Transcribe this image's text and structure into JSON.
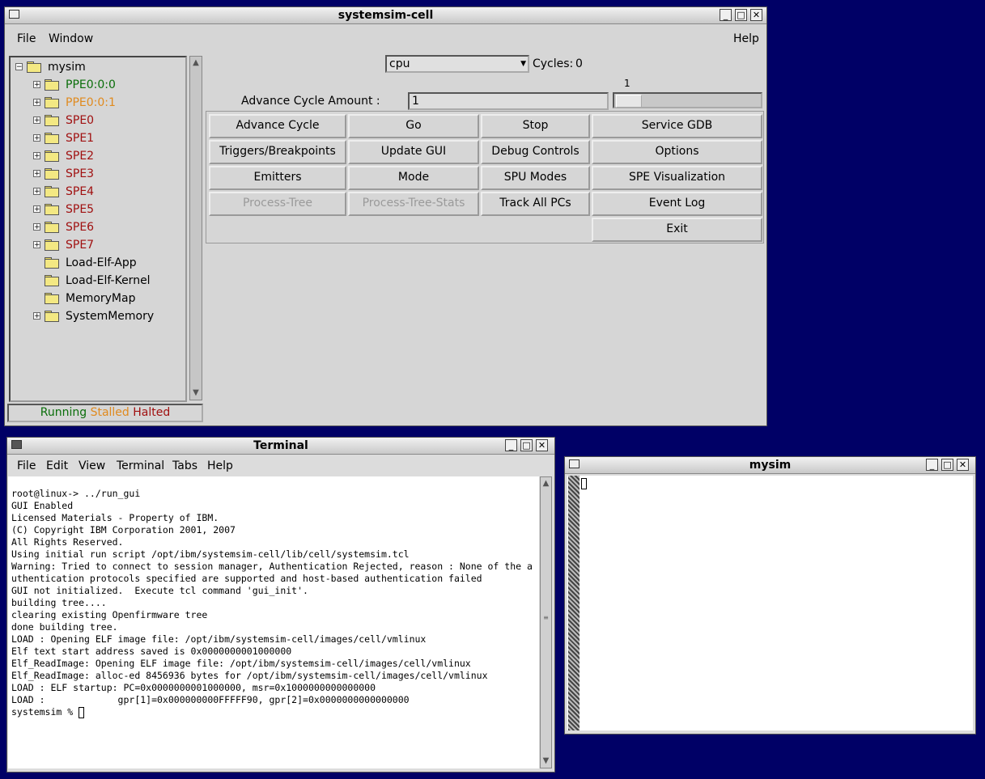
{
  "main_window": {
    "title": "systemsim-cell",
    "menu": {
      "file": "File",
      "window": "Window",
      "help": "Help"
    },
    "tree": [
      {
        "label": "mysim",
        "expander": "minus",
        "color": "#000000"
      },
      {
        "label": "PPE0:0:0",
        "expander": "plus",
        "color": "#0a6e0a"
      },
      {
        "label": "PPE0:0:1",
        "expander": "plus",
        "color": "#e08a1e"
      },
      {
        "label": "SPE0",
        "expander": "plus",
        "color": "#a01010"
      },
      {
        "label": "SPE1",
        "expander": "plus",
        "color": "#a01010"
      },
      {
        "label": "SPE2",
        "expander": "plus",
        "color": "#a01010"
      },
      {
        "label": "SPE3",
        "expander": "plus",
        "color": "#a01010"
      },
      {
        "label": "SPE4",
        "expander": "plus",
        "color": "#a01010"
      },
      {
        "label": "SPE5",
        "expander": "plus",
        "color": "#a01010"
      },
      {
        "label": "SPE6",
        "expander": "plus",
        "color": "#a01010"
      },
      {
        "label": "SPE7",
        "expander": "plus",
        "color": "#a01010"
      },
      {
        "label": "Load-Elf-App",
        "expander": "none",
        "color": "#000000"
      },
      {
        "label": "Load-Elf-Kernel",
        "expander": "none",
        "color": "#000000"
      },
      {
        "label": "MemoryMap",
        "expander": "none",
        "color": "#000000"
      },
      {
        "label": "SystemMemory",
        "expander": "plus",
        "color": "#000000"
      }
    ],
    "legend": {
      "running": "Running",
      "stalled": "Stalled",
      "halted": "Halted"
    },
    "colors": {
      "running": "#0a6e0a",
      "stalled": "#e08a1e",
      "halted": "#a01010"
    },
    "cpu_select": "cpu",
    "cycles_label": "Cycles:",
    "cycles_value": "0",
    "advance_label": "Advance Cycle Amount :",
    "advance_value": "1",
    "slider_value_label": "1",
    "buttons": {
      "advance_cycle": "Advance Cycle",
      "go": "Go",
      "stop": "Stop",
      "service_gdb": "Service GDB",
      "triggers": "Triggers/Breakpoints",
      "update_gui": "Update GUI",
      "debug_controls": "Debug Controls",
      "options": "Options",
      "emitters": "Emitters",
      "mode": "Mode",
      "spu_modes": "SPU Modes",
      "spe_visualization": "SPE Visualization",
      "process_tree": "Process-Tree",
      "process_tree_stats": "Process-Tree-Stats",
      "track_all_pcs": "Track All PCs",
      "event_log": "Event Log",
      "exit": "Exit"
    }
  },
  "terminal_window": {
    "title": "Terminal",
    "menu": {
      "file": "File",
      "edit": "Edit",
      "view": "View",
      "terminal": "Terminal",
      "tabs": "Tabs",
      "help": "Help"
    },
    "lines": [
      "root@linux-> ../run_gui",
      "GUI Enabled",
      "Licensed Materials - Property of IBM.",
      "(C) Copyright IBM Corporation 2001, 2007",
      "All Rights Reserved.",
      "Using initial run script /opt/ibm/systemsim-cell/lib/cell/systemsim.tcl",
      "Warning: Tried to connect to session manager, Authentication Rejected, reason : None of the a",
      "uthentication protocols specified are supported and host-based authentication failed",
      "GUI not initialized.  Execute tcl command 'gui_init'.",
      "building tree....",
      "clearing existing Openfirmware tree",
      "done building tree.",
      "LOAD : Opening ELF image file: /opt/ibm/systemsim-cell/images/cell/vmlinux",
      "Elf text start address saved is 0x0000000001000000",
      "Elf_ReadImage: Opening ELF image file: /opt/ibm/systemsim-cell/images/cell/vmlinux",
      "Elf_ReadImage: alloc-ed 8456936 bytes for /opt/ibm/systemsim-cell/images/cell/vmlinux",
      "LOAD : ELF startup: PC=0x0000000001000000, msr=0x1000000000000000",
      "LOAD :             gpr[1]=0x000000000FFFFF90, gpr[2]=0x0000000000000000"
    ],
    "prompt": "systemsim % "
  },
  "mysim_window": {
    "title": "mysim"
  }
}
